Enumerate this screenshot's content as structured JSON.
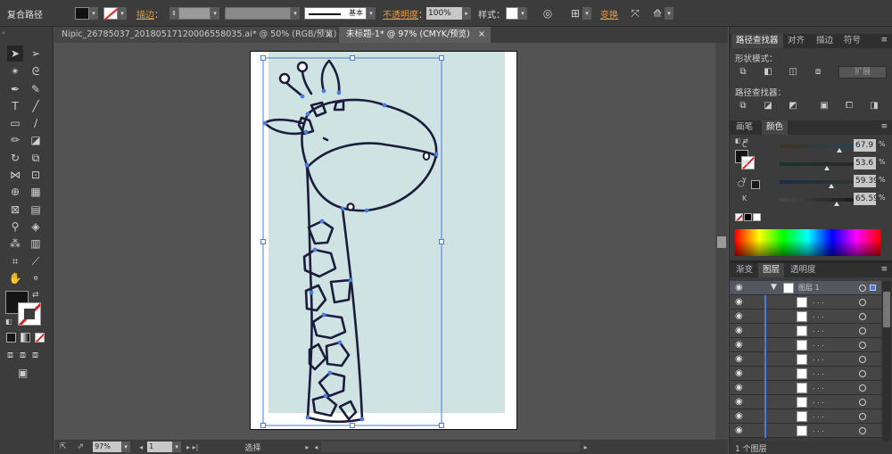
{
  "control_bar": {
    "selection_type": "复合路径",
    "stroke_label": "描边",
    "stroke_profile": "基本",
    "opacity_label": "不透明度",
    "opacity_value": "100%",
    "style_label": "样式",
    "transform_label": "变换",
    "fill_color": "#1a1a1a",
    "accent_color": "#e89a3c"
  },
  "tabs": [
    {
      "label": "Nipic_26785037_20180517120006558035.ai* @ 50% (RGB/预览)",
      "close": "×"
    },
    {
      "label": "未标题-1* @ 97% (CMYK/预览)",
      "close": "×"
    }
  ],
  "artboard": {
    "background_color": "#cfe3e3",
    "stroke_color": "#1c1c3c",
    "selection_color": "#4a7be0"
  },
  "status_bar": {
    "zoom": "97%",
    "page": "1",
    "status": "选择"
  },
  "pathfinder_panel": {
    "tabs": [
      "路径查找器",
      "对齐",
      "描边",
      "符号"
    ],
    "shape_modes_label": "形状模式：",
    "expand_button": "扩展",
    "pathfinders_label": "路径查找器："
  },
  "color_panel": {
    "tabs": [
      "画笔",
      "颜色"
    ],
    "channels": [
      {
        "name": "C",
        "value": "67.9",
        "unit": "%",
        "level": 0.679
      },
      {
        "name": "M",
        "value": "53.6",
        "unit": "%",
        "level": 0.536
      },
      {
        "name": "Y",
        "value": "59.39",
        "unit": "%",
        "level": 0.5939
      },
      {
        "name": "K",
        "value": "65.59",
        "unit": "%",
        "level": 0.6559
      }
    ]
  },
  "layers_panel": {
    "tabs": [
      "渐变",
      "图层",
      "透明度"
    ],
    "layer_name": "图层 1",
    "sublayer_label": ". . .",
    "footer": "1 个图层"
  },
  "icons": [
    "selection-tool-icon",
    "direct-selection-icon",
    "magic-wand-icon",
    "lasso-icon",
    "pen-tool-icon",
    "type-tool-icon",
    "rectangle-tool-icon",
    "hand-tool-icon",
    "zoom-tool-icon",
    "eye-icon"
  ]
}
